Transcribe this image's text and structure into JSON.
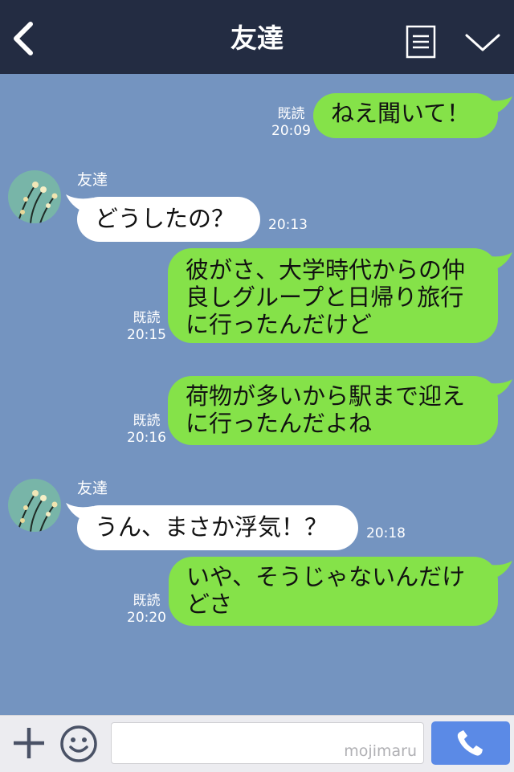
{
  "header": {
    "title": "友達"
  },
  "colors": {
    "header_bg": "#232c42",
    "chat_bg": "#7494c0",
    "my_bubble": "#85e249",
    "their_bubble": "#ffffff",
    "call_button": "#5b8ae6"
  },
  "icons": [
    "back-chevron-icon",
    "menu-list-icon",
    "dropdown-chevron-icon",
    "plus-icon",
    "emoji-icon",
    "phone-icon"
  ],
  "messages": [
    {
      "from": "me",
      "text": "ねえ聞いて！",
      "read": "既読",
      "time": "20:09"
    },
    {
      "from": "them",
      "sender": "友達",
      "text": "どうしたの？",
      "time": "20:13"
    },
    {
      "from": "me",
      "lines": [
        "彼がさ、大学時代からの仲",
        "良しグループと日帰り旅行",
        "に行ったんだけど"
      ],
      "read": "既読",
      "time": "20:15"
    },
    {
      "from": "me",
      "lines": [
        "荷物が多いから駅まで迎え",
        "に行ったんだよね"
      ],
      "read": "既読",
      "time": "20:16"
    },
    {
      "from": "them",
      "sender": "友達",
      "text": "うん、まさか浮気！？",
      "time": "20:18"
    },
    {
      "from": "me",
      "lines": [
        "いや、そうじゃないんだけ",
        "どさ"
      ],
      "read": "既読",
      "time": "20:20"
    }
  ],
  "footer": {
    "watermark": "mojimaru",
    "input_value": ""
  }
}
